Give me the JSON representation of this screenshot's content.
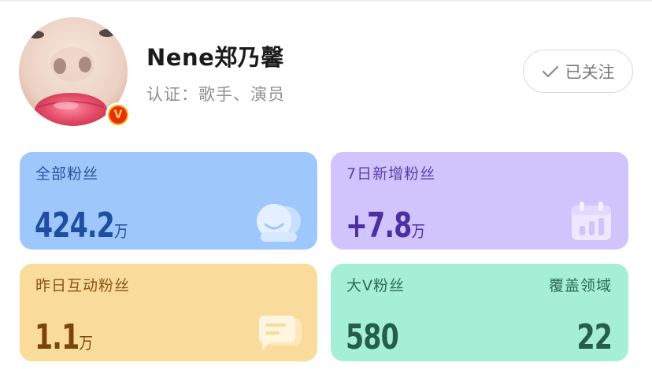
{
  "profile": {
    "name": "Nene郑乃馨",
    "certification": "认证：歌手、演员",
    "badge_glyph": "V",
    "avatar_icon": "avatar-photo",
    "verify_icon": "verified-v-badge-icon"
  },
  "follow_button": {
    "label": "已关注",
    "icon": "check-icon",
    "state": "following"
  },
  "stats": {
    "all_fans": {
      "label": "全部粉丝",
      "value": "424.2",
      "unit": "万",
      "icon": "fans-group-icon",
      "color": "#9ec8fb"
    },
    "new_fans_7d": {
      "label": "7日新增粉丝",
      "value": "+7.8",
      "unit": "万",
      "icon": "calendar-chart-icon",
      "color": "#d1c4fd"
    },
    "interactive_fans_yesterday": {
      "label": "昨日互动粉丝",
      "value": "1.1",
      "unit": "万",
      "icon": "chat-bubbles-icon",
      "color": "#f9dc9b"
    },
    "big_v_fans": {
      "label": "大V粉丝",
      "value": "580",
      "color": "#a5efd6"
    },
    "covered_fields": {
      "label": "覆盖领域",
      "value": "22"
    }
  }
}
